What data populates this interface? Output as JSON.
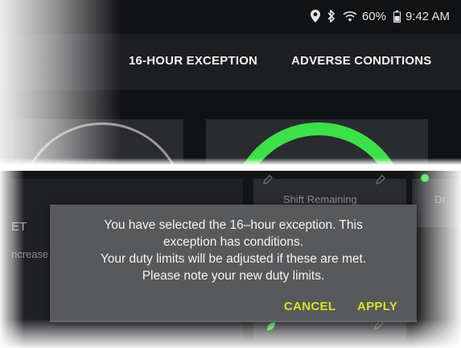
{
  "status_bar": {
    "icons": [
      "location-pin-icon",
      "bluetooth-icon",
      "wifi-icon",
      "battery-icon"
    ],
    "battery": "60%",
    "time": "9:42 AM"
  },
  "action_bar": {
    "buttons": [
      "16-HOUR EXCEPTION",
      "ADVERSE CONDITIONS"
    ]
  },
  "background": {
    "card_mid_label": "Shift Remaining",
    "card_right_label": "Dr",
    "left_label_top": "ET",
    "left_label_bottom": "ncrease"
  },
  "dialog": {
    "lines": [
      "You have selected the 16–hour exception. This",
      "exception has conditions.",
      "Your duty limits will be adjusted if these are met.",
      "Please note your new duty limits."
    ],
    "cancel_label": "CANCEL",
    "apply_label": "APPLY"
  },
  "colors": {
    "accent_green": "#3ce049",
    "dialog_button": "#d7e02a",
    "dialog_background": "#58595b"
  }
}
